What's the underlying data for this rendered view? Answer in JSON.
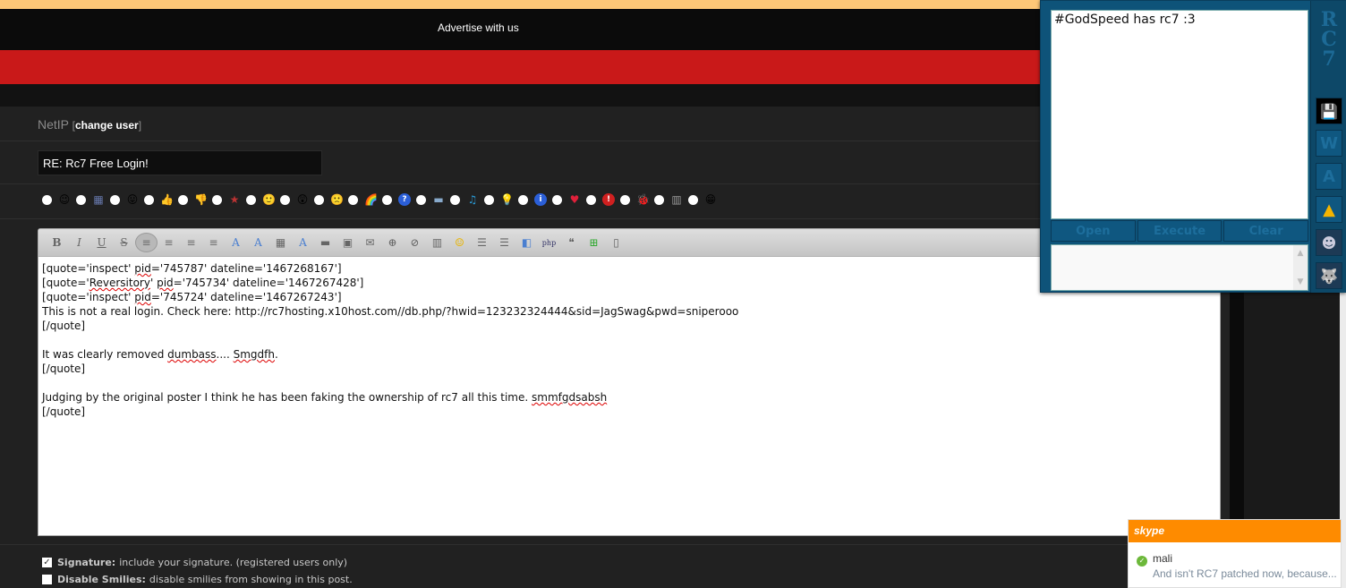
{
  "header": {
    "ad_link": "Advertise with us"
  },
  "user": {
    "username": "NetIP",
    "bracket_open": "[",
    "change_user": "change user",
    "bracket_close": "]"
  },
  "subject": {
    "value": "RE: Rc7 Free Login!"
  },
  "post_icons": [
    {
      "name": "wink",
      "glyph": "😉"
    },
    {
      "name": "film",
      "glyph": "▦"
    },
    {
      "name": "tongue",
      "glyph": "😛"
    },
    {
      "name": "thumbs-up",
      "glyph": "👍"
    },
    {
      "name": "thumbs-down",
      "glyph": "👎"
    },
    {
      "name": "star",
      "glyph": "★"
    },
    {
      "name": "smile",
      "glyph": "🙂"
    },
    {
      "name": "shocked",
      "glyph": "😲"
    },
    {
      "name": "sad",
      "glyph": "🙁"
    },
    {
      "name": "rainbow",
      "glyph": "🌈"
    },
    {
      "name": "question",
      "glyph": "?"
    },
    {
      "name": "image",
      "glyph": "▬"
    },
    {
      "name": "music",
      "glyph": "♫"
    },
    {
      "name": "lightbulb",
      "glyph": "💡"
    },
    {
      "name": "info",
      "glyph": "i"
    },
    {
      "name": "heart",
      "glyph": "♥"
    },
    {
      "name": "exclamation",
      "glyph": "!"
    },
    {
      "name": "bug",
      "glyph": "🐞"
    },
    {
      "name": "castle",
      "glyph": "▥"
    },
    {
      "name": "grin",
      "glyph": "😁"
    }
  ],
  "toolbar": {
    "buttons": [
      {
        "name": "bold",
        "glyph": "B"
      },
      {
        "name": "italic",
        "glyph": "I"
      },
      {
        "name": "underline",
        "glyph": "U"
      },
      {
        "name": "strikethrough",
        "glyph": "S"
      },
      {
        "name": "align-left",
        "glyph": "≡"
      },
      {
        "name": "align-center",
        "glyph": "≡"
      },
      {
        "name": "align-right",
        "glyph": "≡"
      },
      {
        "name": "justify",
        "glyph": "≡"
      },
      {
        "name": "font",
        "glyph": "A"
      },
      {
        "name": "font-size",
        "glyph": "A"
      },
      {
        "name": "color",
        "glyph": "▦"
      },
      {
        "name": "remove-format",
        "glyph": "A"
      },
      {
        "name": "horizontal-rule",
        "glyph": "▬"
      },
      {
        "name": "insert-image",
        "glyph": "▣"
      },
      {
        "name": "insert-email",
        "glyph": "✉"
      },
      {
        "name": "insert-link",
        "glyph": "⊕"
      },
      {
        "name": "unlink",
        "glyph": "⊘"
      },
      {
        "name": "insert-video",
        "glyph": "▥"
      },
      {
        "name": "insert-emoticon",
        "glyph": "☺"
      },
      {
        "name": "bullet-list",
        "glyph": "☰"
      },
      {
        "name": "ordered-list",
        "glyph": "☰"
      },
      {
        "name": "code",
        "glyph": "◧"
      },
      {
        "name": "php",
        "glyph": "php"
      },
      {
        "name": "quote",
        "glyph": "❝"
      },
      {
        "name": "maximize",
        "glyph": "⊞"
      },
      {
        "name": "source",
        "glyph": "▯"
      }
    ]
  },
  "editor": {
    "lines": [
      {
        "segments": [
          {
            "t": "[quote='inspect' "
          },
          {
            "t": "pid",
            "err": true
          },
          {
            "t": "='745787' dateline='1467268167']"
          }
        ]
      },
      {
        "segments": [
          {
            "t": "[quote='"
          },
          {
            "t": "Reversitory",
            "err": true
          },
          {
            "t": "' "
          },
          {
            "t": "pid",
            "err": true
          },
          {
            "t": "='745734' dateline='1467267428']"
          }
        ]
      },
      {
        "segments": [
          {
            "t": "[quote='inspect' "
          },
          {
            "t": "pid",
            "err": true
          },
          {
            "t": "='745724' dateline='1467267243']"
          }
        ]
      },
      {
        "segments": [
          {
            "t": "This is not a real login. Check here: http://rc7hosting.x10host.com//db.php/?hwid=123232324444&sid=JagSwag&pwd=sniperooo"
          }
        ]
      },
      {
        "segments": [
          {
            "t": "[/quote]"
          }
        ]
      },
      {
        "segments": [
          {
            "t": ""
          }
        ]
      },
      {
        "segments": [
          {
            "t": "It was clearly removed "
          },
          {
            "t": "dumbass",
            "err": true
          },
          {
            "t": ".... "
          },
          {
            "t": "Smgdfh",
            "err": true
          },
          {
            "t": "."
          }
        ]
      },
      {
        "segments": [
          {
            "t": "[/quote]"
          }
        ]
      },
      {
        "segments": [
          {
            "t": ""
          }
        ]
      },
      {
        "segments": [
          {
            "t": "Judging by the original poster I think he has been faking the ownership of rc7 all this time. "
          },
          {
            "t": "smmfgdsabsh",
            "err": true
          }
        ]
      },
      {
        "segments": [
          {
            "t": "[/quote]"
          }
        ]
      }
    ]
  },
  "options": {
    "signature": {
      "checked": true,
      "label": "Signature:",
      "desc": "include your signature. (registered users only)"
    },
    "disable_smilies": {
      "checked": false,
      "label": "Disable Smilies:",
      "desc": "disable smilies from showing in this post."
    }
  },
  "rc7": {
    "script_text": "#GodSpeed has rc7 :3",
    "logo": "RC7",
    "open_label": "Open",
    "execute_label": "Execute",
    "clear_label": "Clear",
    "side_buttons": [
      {
        "name": "save-icon",
        "glyph": "💾"
      },
      {
        "name": "w-icon",
        "glyph": "W"
      },
      {
        "name": "a-icon",
        "glyph": "A"
      },
      {
        "name": "drive-icon",
        "glyph": "▲"
      },
      {
        "name": "avatar-anime-icon",
        "glyph": "☻"
      },
      {
        "name": "avatar-wolf-icon",
        "glyph": "🐺"
      }
    ]
  },
  "skype": {
    "logo": "skype",
    "contact": "mali",
    "message": "And isn't RC7 patched now, because..."
  },
  "colors": {
    "top_strip": "#fdc777",
    "red_bar": "#c91919",
    "rc7_blue": "#0e5379",
    "skype_orange": "#fe8b00"
  }
}
